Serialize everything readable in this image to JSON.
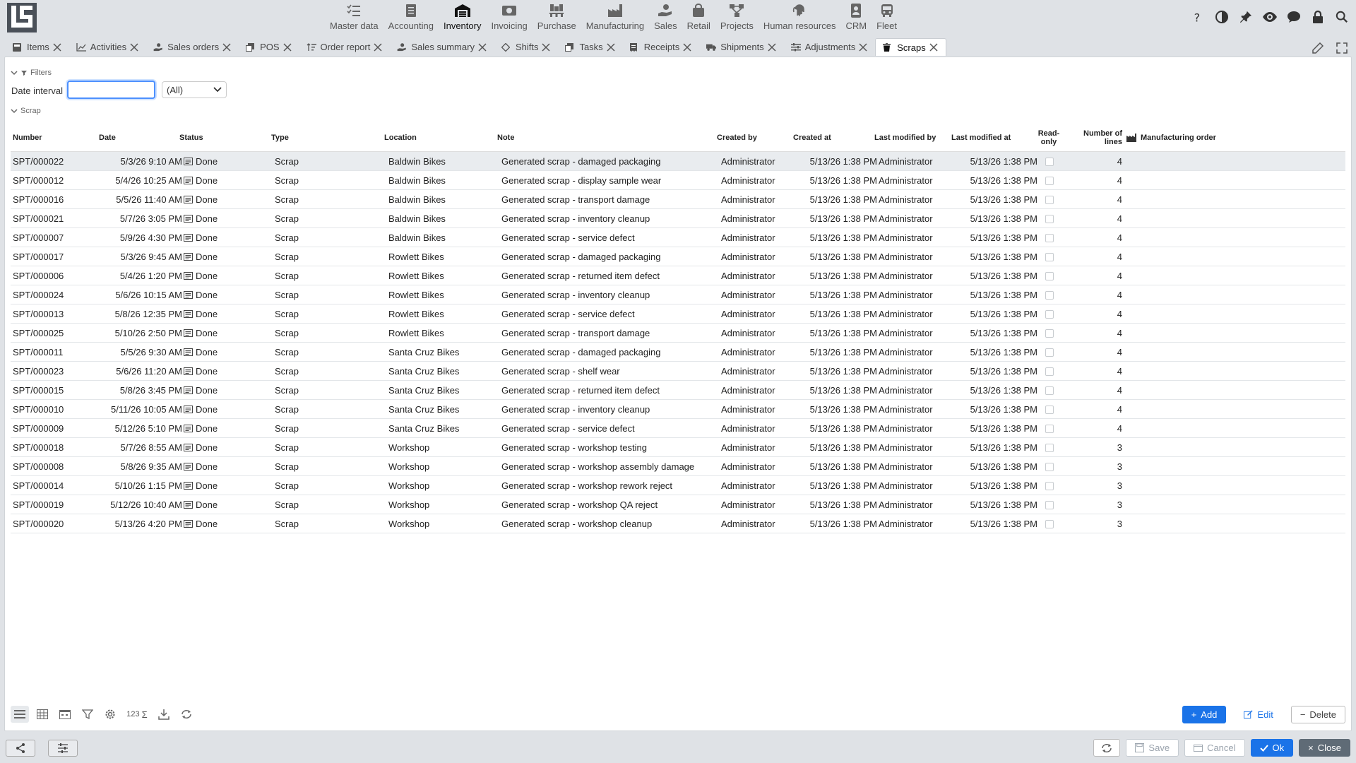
{
  "modules": [
    {
      "label": "Master data",
      "icon": "list-check-icon",
      "active": false
    },
    {
      "label": "Accounting",
      "icon": "ledger-icon",
      "active": false
    },
    {
      "label": "Inventory",
      "icon": "warehouse-icon",
      "active": true
    },
    {
      "label": "Invoicing",
      "icon": "banknote-icon",
      "active": false
    },
    {
      "label": "Purchase",
      "icon": "pallet-icon",
      "active": false
    },
    {
      "label": "Manufacturing",
      "icon": "factory-icon",
      "active": false
    },
    {
      "label": "Sales",
      "icon": "hand-coin-icon",
      "active": false
    },
    {
      "label": "Retail",
      "icon": "shopping-bag-icon",
      "active": false
    },
    {
      "label": "Projects",
      "icon": "project-diagram-icon",
      "active": false
    },
    {
      "label": "Human resources",
      "icon": "fingerprint-icon",
      "active": false
    },
    {
      "label": "CRM",
      "icon": "contact-card-icon",
      "active": false
    },
    {
      "label": "Fleet",
      "icon": "bus-icon",
      "active": false
    }
  ],
  "tabs": [
    {
      "label": "Items",
      "icon": "item-icon"
    },
    {
      "label": "Activities",
      "icon": "chart-line-icon"
    },
    {
      "label": "Sales orders",
      "icon": "hand-coin-icon"
    },
    {
      "label": "POS",
      "icon": "copy-icon"
    },
    {
      "label": "Order report",
      "icon": "sort-icon"
    },
    {
      "label": "Sales summary",
      "icon": "hand-coin-icon"
    },
    {
      "label": "Shifts",
      "icon": "shifts-icon"
    },
    {
      "label": "Tasks",
      "icon": "copy-icon"
    },
    {
      "label": "Receipts",
      "icon": "receipt-icon"
    },
    {
      "label": "Shipments",
      "icon": "truck-icon"
    },
    {
      "label": "Adjustments",
      "icon": "adjust-icon"
    },
    {
      "label": "Scraps",
      "icon": "trash-icon"
    }
  ],
  "active_tab": "Scraps",
  "filters": {
    "section_label": "Filters",
    "date_interval_label": "Date interval",
    "date_interval_value": "",
    "interval_option": "(All)"
  },
  "scrap_section_label": "Scrap",
  "columns": {
    "number": "Number",
    "date": "Date",
    "status": "Status",
    "type": "Type",
    "location": "Location",
    "note": "Note",
    "created_by": "Created by",
    "created_at": "Created at",
    "last_modified_by": "Last modified by",
    "last_modified_at": "Last modified at",
    "read_only_1": "Read-",
    "read_only_2": "only",
    "lines_1": "Number of",
    "lines_2": "lines",
    "manufacturing_order": "Manufacturing order"
  },
  "rows": [
    {
      "number": "SPT/000022",
      "date": "5/3/26 9:10 AM",
      "status": "Done",
      "type": "Scrap",
      "location": "Baldwin Bikes",
      "note": "Generated scrap - damaged packaging",
      "created_by": "Administrator",
      "created_at": "5/13/26 1:38 PM",
      "last_modified_by": "Administrator",
      "last_modified_at": "5/13/26 1:38 PM",
      "lines": "4",
      "manufacturing_order": ""
    },
    {
      "number": "SPT/000012",
      "date": "5/4/26 10:25 AM",
      "status": "Done",
      "type": "Scrap",
      "location": "Baldwin Bikes",
      "note": "Generated scrap - display sample wear",
      "created_by": "Administrator",
      "created_at": "5/13/26 1:38 PM",
      "last_modified_by": "Administrator",
      "last_modified_at": "5/13/26 1:38 PM",
      "lines": "4",
      "manufacturing_order": ""
    },
    {
      "number": "SPT/000016",
      "date": "5/5/26 11:40 AM",
      "status": "Done",
      "type": "Scrap",
      "location": "Baldwin Bikes",
      "note": "Generated scrap - transport damage",
      "created_by": "Administrator",
      "created_at": "5/13/26 1:38 PM",
      "last_modified_by": "Administrator",
      "last_modified_at": "5/13/26 1:38 PM",
      "lines": "4",
      "manufacturing_order": ""
    },
    {
      "number": "SPT/000021",
      "date": "5/7/26 3:05 PM",
      "status": "Done",
      "type": "Scrap",
      "location": "Baldwin Bikes",
      "note": "Generated scrap - inventory cleanup",
      "created_by": "Administrator",
      "created_at": "5/13/26 1:38 PM",
      "last_modified_by": "Administrator",
      "last_modified_at": "5/13/26 1:38 PM",
      "lines": "4",
      "manufacturing_order": ""
    },
    {
      "number": "SPT/000007",
      "date": "5/9/26 4:30 PM",
      "status": "Done",
      "type": "Scrap",
      "location": "Baldwin Bikes",
      "note": "Generated scrap - service defect",
      "created_by": "Administrator",
      "created_at": "5/13/26 1:38 PM",
      "last_modified_by": "Administrator",
      "last_modified_at": "5/13/26 1:38 PM",
      "lines": "4",
      "manufacturing_order": ""
    },
    {
      "number": "SPT/000017",
      "date": "5/3/26 9:45 AM",
      "status": "Done",
      "type": "Scrap",
      "location": "Rowlett Bikes",
      "note": "Generated scrap - damaged packaging",
      "created_by": "Administrator",
      "created_at": "5/13/26 1:38 PM",
      "last_modified_by": "Administrator",
      "last_modified_at": "5/13/26 1:38 PM",
      "lines": "4",
      "manufacturing_order": ""
    },
    {
      "number": "SPT/000006",
      "date": "5/4/26 1:20 PM",
      "status": "Done",
      "type": "Scrap",
      "location": "Rowlett Bikes",
      "note": "Generated scrap - returned item defect",
      "created_by": "Administrator",
      "created_at": "5/13/26 1:38 PM",
      "last_modified_by": "Administrator",
      "last_modified_at": "5/13/26 1:38 PM",
      "lines": "4",
      "manufacturing_order": ""
    },
    {
      "number": "SPT/000024",
      "date": "5/6/26 10:15 AM",
      "status": "Done",
      "type": "Scrap",
      "location": "Rowlett Bikes",
      "note": "Generated scrap - inventory cleanup",
      "created_by": "Administrator",
      "created_at": "5/13/26 1:38 PM",
      "last_modified_by": "Administrator",
      "last_modified_at": "5/13/26 1:38 PM",
      "lines": "4",
      "manufacturing_order": ""
    },
    {
      "number": "SPT/000013",
      "date": "5/8/26 12:35 PM",
      "status": "Done",
      "type": "Scrap",
      "location": "Rowlett Bikes",
      "note": "Generated scrap - service defect",
      "created_by": "Administrator",
      "created_at": "5/13/26 1:38 PM",
      "last_modified_by": "Administrator",
      "last_modified_at": "5/13/26 1:38 PM",
      "lines": "4",
      "manufacturing_order": ""
    },
    {
      "number": "SPT/000025",
      "date": "5/10/26 2:50 PM",
      "status": "Done",
      "type": "Scrap",
      "location": "Rowlett Bikes",
      "note": "Generated scrap - transport damage",
      "created_by": "Administrator",
      "created_at": "5/13/26 1:38 PM",
      "last_modified_by": "Administrator",
      "last_modified_at": "5/13/26 1:38 PM",
      "lines": "4",
      "manufacturing_order": ""
    },
    {
      "number": "SPT/000011",
      "date": "5/5/26 9:30 AM",
      "status": "Done",
      "type": "Scrap",
      "location": "Santa Cruz Bikes",
      "note": "Generated scrap - damaged packaging",
      "created_by": "Administrator",
      "created_at": "5/13/26 1:38 PM",
      "last_modified_by": "Administrator",
      "last_modified_at": "5/13/26 1:38 PM",
      "lines": "4",
      "manufacturing_order": ""
    },
    {
      "number": "SPT/000023",
      "date": "5/6/26 11:20 AM",
      "status": "Done",
      "type": "Scrap",
      "location": "Santa Cruz Bikes",
      "note": "Generated scrap - shelf wear",
      "created_by": "Administrator",
      "created_at": "5/13/26 1:38 PM",
      "last_modified_by": "Administrator",
      "last_modified_at": "5/13/26 1:38 PM",
      "lines": "4",
      "manufacturing_order": ""
    },
    {
      "number": "SPT/000015",
      "date": "5/8/26 3:45 PM",
      "status": "Done",
      "type": "Scrap",
      "location": "Santa Cruz Bikes",
      "note": "Generated scrap - returned item defect",
      "created_by": "Administrator",
      "created_at": "5/13/26 1:38 PM",
      "last_modified_by": "Administrator",
      "last_modified_at": "5/13/26 1:38 PM",
      "lines": "4",
      "manufacturing_order": ""
    },
    {
      "number": "SPT/000010",
      "date": "5/11/26 10:05 AM",
      "status": "Done",
      "type": "Scrap",
      "location": "Santa Cruz Bikes",
      "note": "Generated scrap - inventory cleanup",
      "created_by": "Administrator",
      "created_at": "5/13/26 1:38 PM",
      "last_modified_by": "Administrator",
      "last_modified_at": "5/13/26 1:38 PM",
      "lines": "4",
      "manufacturing_order": ""
    },
    {
      "number": "SPT/000009",
      "date": "5/12/26 5:10 PM",
      "status": "Done",
      "type": "Scrap",
      "location": "Santa Cruz Bikes",
      "note": "Generated scrap - service defect",
      "created_by": "Administrator",
      "created_at": "5/13/26 1:38 PM",
      "last_modified_by": "Administrator",
      "last_modified_at": "5/13/26 1:38 PM",
      "lines": "4",
      "manufacturing_order": ""
    },
    {
      "number": "SPT/000018",
      "date": "5/7/26 8:55 AM",
      "status": "Done",
      "type": "Scrap",
      "location": "Workshop",
      "note": "Generated scrap - workshop testing",
      "created_by": "Administrator",
      "created_at": "5/13/26 1:38 PM",
      "last_modified_by": "Administrator",
      "last_modified_at": "5/13/26 1:38 PM",
      "lines": "3",
      "manufacturing_order": ""
    },
    {
      "number": "SPT/000008",
      "date": "5/8/26 9:35 AM",
      "status": "Done",
      "type": "Scrap",
      "location": "Workshop",
      "note": "Generated scrap - workshop assembly damage",
      "created_by": "Administrator",
      "created_at": "5/13/26 1:38 PM",
      "last_modified_by": "Administrator",
      "last_modified_at": "5/13/26 1:38 PM",
      "lines": "3",
      "manufacturing_order": ""
    },
    {
      "number": "SPT/000014",
      "date": "5/10/26 1:15 PM",
      "status": "Done",
      "type": "Scrap",
      "location": "Workshop",
      "note": "Generated scrap - workshop rework reject",
      "created_by": "Administrator",
      "created_at": "5/13/26 1:38 PM",
      "last_modified_by": "Administrator",
      "last_modified_at": "5/13/26 1:38 PM",
      "lines": "3",
      "manufacturing_order": ""
    },
    {
      "number": "SPT/000019",
      "date": "5/12/26 10:40 AM",
      "status": "Done",
      "type": "Scrap",
      "location": "Workshop",
      "note": "Generated scrap - workshop QA reject",
      "created_by": "Administrator",
      "created_at": "5/13/26 1:38 PM",
      "last_modified_by": "Administrator",
      "last_modified_at": "5/13/26 1:38 PM",
      "lines": "3",
      "manufacturing_order": ""
    },
    {
      "number": "SPT/000020",
      "date": "5/13/26 4:20 PM",
      "status": "Done",
      "type": "Scrap",
      "location": "Workshop",
      "note": "Generated scrap - workshop cleanup",
      "created_by": "Administrator",
      "created_at": "5/13/26 1:38 PM",
      "last_modified_by": "Administrator",
      "last_modified_at": "5/13/26 1:38 PM",
      "lines": "3",
      "manufacturing_order": ""
    }
  ],
  "toolbar": {
    "sum_label": "123",
    "add_label": "Add",
    "edit_label": "Edit",
    "delete_label": "Delete"
  },
  "footer": {
    "save_label": "Save",
    "cancel_label": "Cancel",
    "ok_label": "Ok",
    "close_label": "Close"
  },
  "colors": {
    "accent": "#1a73e8",
    "selected_row": "#e9ecef",
    "topbar_bg": "#dfe2e6"
  }
}
